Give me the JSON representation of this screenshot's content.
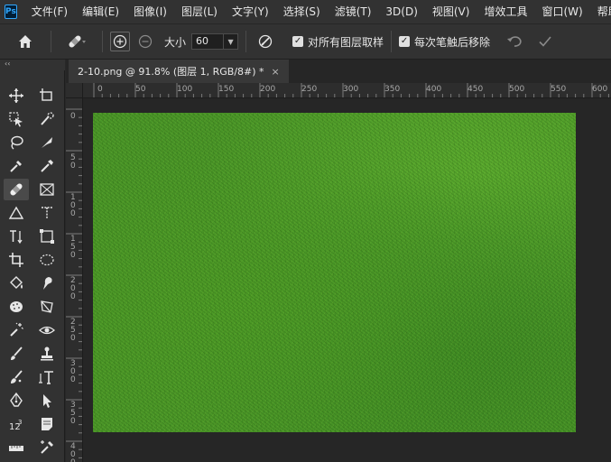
{
  "app": {
    "logo_text": "Ps"
  },
  "menu": [
    {
      "label": "文件(F)"
    },
    {
      "label": "编辑(E)"
    },
    {
      "label": "图像(I)"
    },
    {
      "label": "图层(L)"
    },
    {
      "label": "文字(Y)"
    },
    {
      "label": "选择(S)"
    },
    {
      "label": "滤镜(T)"
    },
    {
      "label": "3D(D)"
    },
    {
      "label": "视图(V)"
    },
    {
      "label": "增效工具"
    },
    {
      "label": "窗口(W)"
    },
    {
      "label": "帮助(H)"
    }
  ],
  "options": {
    "size_label": "大小",
    "size_value": "60",
    "sample_all_layers_label": "对所有图层取样",
    "sample_all_layers_checked": true,
    "remove_after_stroke_label": "每次笔触后移除",
    "remove_after_stroke_checked": true,
    "check_glyph": "✓"
  },
  "toolbar": {
    "collapse_glyph": "‹‹",
    "selected_tool": "remove-tool"
  },
  "document": {
    "tab_title": "2-10.png @ 91.8% (图层 1, RGB/8#) *",
    "close_glyph": "×"
  },
  "ruler": {
    "horizontal_labels": [
      "0",
      "50",
      "100",
      "150",
      "200",
      "250",
      "300",
      "350",
      "400",
      "450",
      "500",
      "550",
      "600"
    ],
    "vertical_labels": [
      "0",
      "5 0",
      "1 0 0",
      "1 5 0",
      "2 0 0",
      "2 5 0",
      "3 0 0",
      "3 5 0",
      "4 0 0"
    ]
  },
  "colors": {
    "accent": "#31a8ff",
    "panel": "#323232",
    "canvas_bg": "#262626",
    "grass": "#4a9628"
  }
}
